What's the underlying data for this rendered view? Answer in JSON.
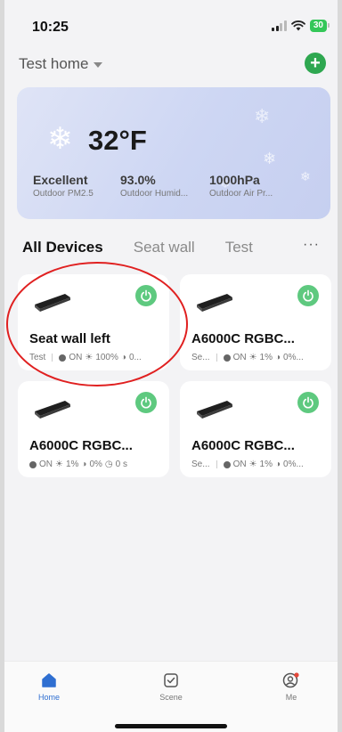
{
  "status_bar": {
    "time": "10:25",
    "battery": "30"
  },
  "header": {
    "home_name": "Test home",
    "add_icon": "plus-circle-icon"
  },
  "weather": {
    "temperature": "32°F",
    "condition_icon": "snowflake-icon",
    "stats": [
      {
        "value": "Excellent",
        "label": "Outdoor PM2.5"
      },
      {
        "value": "93.0%",
        "label": "Outdoor Humid..."
      },
      {
        "value": "1000hPa",
        "label": "Outdoor Air Pr..."
      }
    ]
  },
  "tabs": {
    "items": [
      "All Devices",
      "Seat wall",
      "Test"
    ],
    "active": "All Devices",
    "more": "···"
  },
  "devices": [
    {
      "name": "Seat wall left",
      "room": "Test",
      "state": "ON",
      "brightness": "100%",
      "extra": "0..."
    },
    {
      "name": "A6000C RGBC...",
      "room": "Se...",
      "state": "ON",
      "brightness": "1%",
      "extra": "0%..."
    },
    {
      "name": "A6000C RGBC...",
      "room": "",
      "state": "ON",
      "brightness": "1%",
      "extra": "0%",
      "timer": "0 s"
    },
    {
      "name": "A6000C RGBC...",
      "room": "Se...",
      "state": "ON",
      "brightness": "1%",
      "extra": "0%..."
    }
  ],
  "bottom_nav": [
    {
      "label": "Home",
      "icon": "home-icon",
      "active": true
    },
    {
      "label": "Scene",
      "icon": "checkbox-icon",
      "active": false
    },
    {
      "label": "Me",
      "icon": "user-icon",
      "active": false
    }
  ],
  "colors": {
    "accent_green": "#2ea750",
    "power_green": "#5ec97f",
    "nav_active": "#2f6fd1",
    "annotation_red": "#e02020"
  }
}
